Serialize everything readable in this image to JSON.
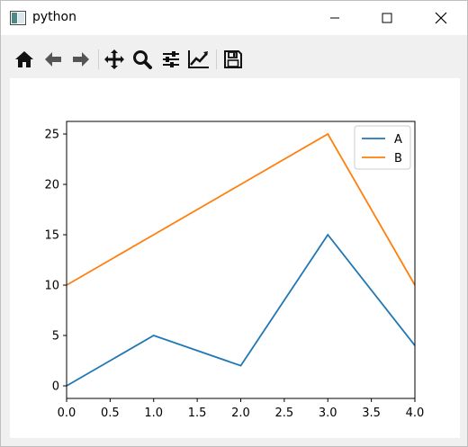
{
  "window": {
    "title": "python",
    "controls": {
      "minimize": "minimize",
      "maximize": "maximize",
      "close": "close"
    }
  },
  "toolbar": {
    "tools": [
      {
        "icon": "home-icon",
        "name": "home"
      },
      {
        "icon": "back-arrow-icon",
        "name": "back"
      },
      {
        "icon": "forward-arrow-icon",
        "name": "forward"
      },
      {
        "icon": "pan-icon",
        "name": "pan"
      },
      {
        "icon": "zoom-icon",
        "name": "zoom"
      },
      {
        "icon": "configure-subplots-icon",
        "name": "configure-subplots"
      },
      {
        "icon": "edit-axis-icon",
        "name": "edit-axis"
      },
      {
        "icon": "save-icon",
        "name": "save"
      }
    ]
  },
  "colors": {
    "series_a": "#1f77b4",
    "series_b": "#ff7f0e"
  },
  "chart_data": {
    "type": "line",
    "x": [
      0,
      1,
      2,
      3,
      4
    ],
    "series": [
      {
        "name": "A",
        "values": [
          0,
          5,
          2,
          15,
          4
        ]
      },
      {
        "name": "B",
        "values": [
          10,
          15,
          20,
          25,
          10
        ]
      }
    ],
    "xlim": [
      0,
      4
    ],
    "ylim": [
      -1.25,
      26.25
    ],
    "xticks": [
      "0.0",
      "0.5",
      "1.0",
      "1.5",
      "2.0",
      "2.5",
      "3.0",
      "3.5",
      "4.0"
    ],
    "yticks": [
      "0",
      "5",
      "10",
      "15",
      "20",
      "25"
    ],
    "legend": {
      "position": "upper-right"
    },
    "grid": false,
    "title": "",
    "xlabel": "",
    "ylabel": ""
  }
}
